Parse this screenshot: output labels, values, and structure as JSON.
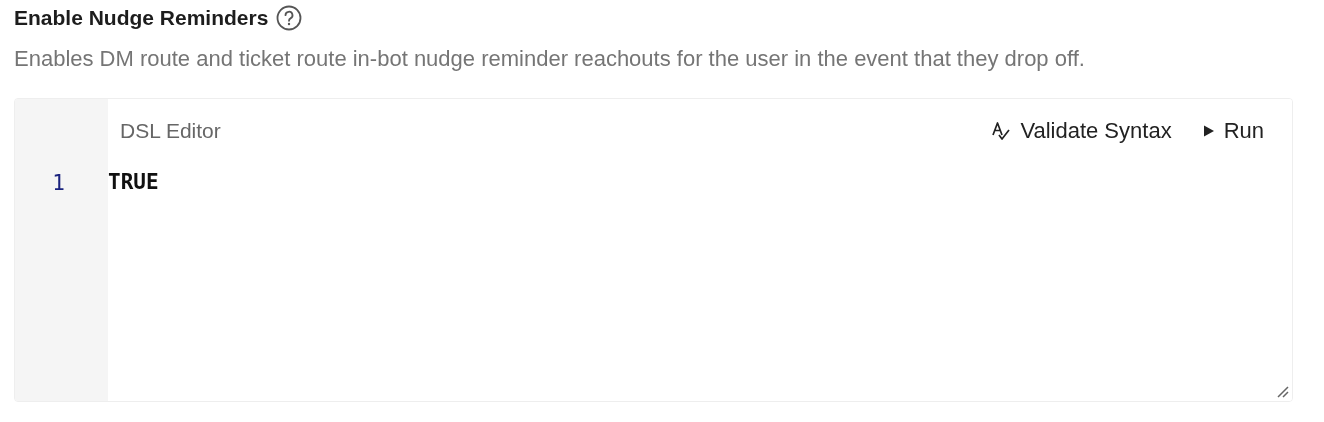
{
  "setting": {
    "title": "Enable Nudge Reminders",
    "description": "Enables DM route and ticket route in-bot nudge reminder reachouts for the user in the event that they drop off."
  },
  "editor": {
    "title": "DSL Editor",
    "actions": [
      {
        "kind": "validate",
        "label": "Validate Syntax"
      },
      {
        "kind": "run",
        "label": "Run"
      }
    ],
    "lines": [
      {
        "number": "1",
        "code": "TRUE"
      }
    ]
  }
}
